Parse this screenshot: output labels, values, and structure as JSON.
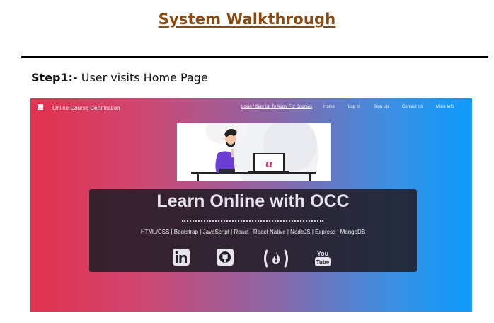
{
  "document": {
    "title": "System Walkthrough",
    "step": {
      "label": "Step1",
      "suffix": ":-",
      "text": " User visits Home Page"
    }
  },
  "screenshot": {
    "navbar": {
      "menu_icon": "hamburger-icon",
      "brand": "Online Course Certification",
      "apply_link": "Login / Sign Up To Apply For Courses",
      "items": [
        "Home",
        "Log In",
        "Sign Up",
        "Contact Us",
        "More Info"
      ]
    },
    "hero": {
      "heading": "Learn Online with OCC",
      "tech_list": "HTML/CSS | Bootstrap | JavaScript | React | React Native | NodeJS | Express | MongoDB",
      "social_icons": [
        "linkedin-icon",
        "github-icon",
        "freecodecamp-icon",
        "youtube-icon"
      ],
      "youtube_text": [
        "You",
        "Tube"
      ],
      "laptop_logo": "u"
    },
    "colors": {
      "gradient_left": "#e3324e",
      "gradient_right": "#0d9bfc",
      "title_color": "#8a4a12",
      "figure_shirt": "#6b3fd4",
      "laptop_logo": "#d2356a"
    }
  }
}
